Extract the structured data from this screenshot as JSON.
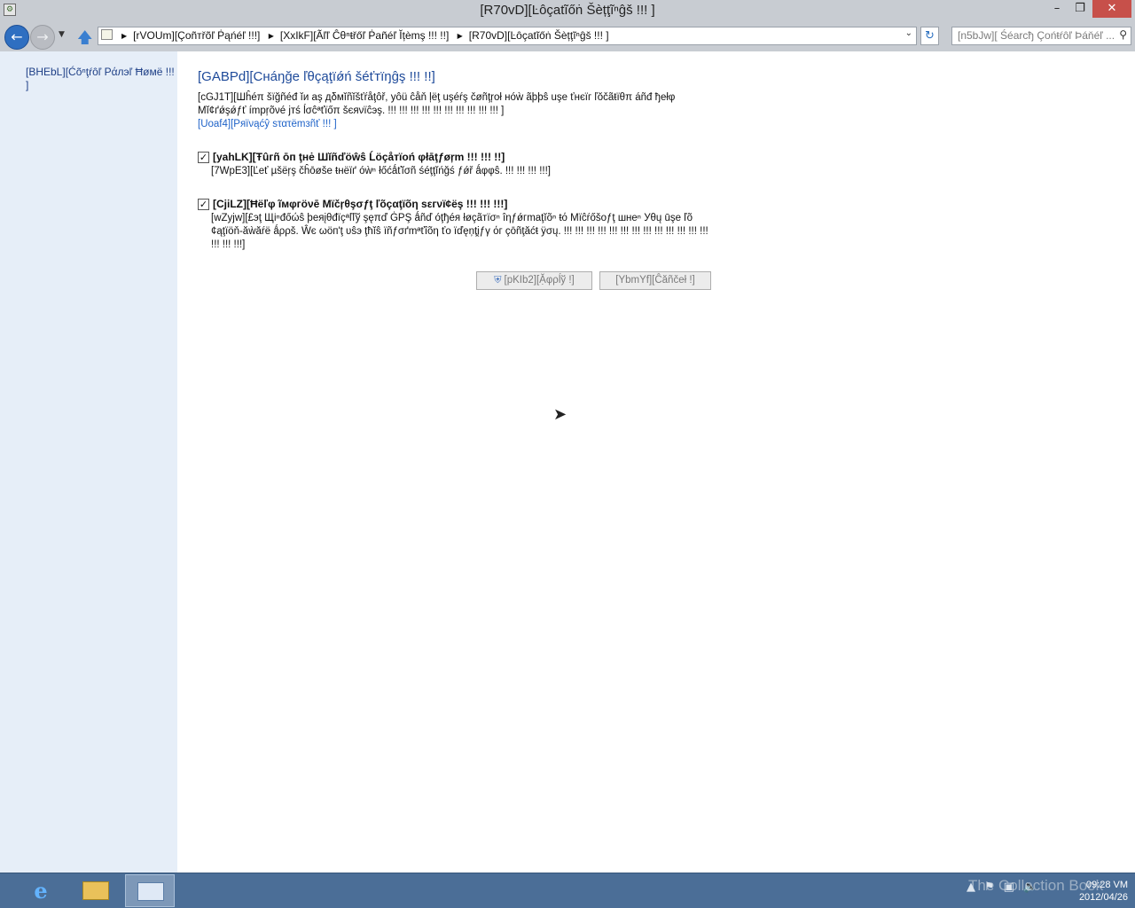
{
  "window": {
    "title": "[R70vD][Ŀôçatĩőṅ Šèțţĩⁿĝš !!! ]",
    "app_icon": "control-panel-icon",
    "controls": {
      "minimize": "–",
      "maximize": "❐",
      "close": "✕"
    }
  },
  "nav": {
    "back_icon": "back-arrow-icon",
    "forward_icon": "forward-arrow-icon",
    "up_icon": "up-arrow-icon",
    "breadcrumbs": [
      "[rVOUm][Çоñтřõľ Ṗąńéľ !!!]",
      "[XxIkF][Ãľľ Ĉθⁿŧřőľ Ṗаñéľ Ĭțèmş !!! !!]",
      "[R70vD][Ŀôçatĩőṅ Šèțţĩⁿĝš !!! ]"
    ],
    "search_placeholder": "[n5bJw][ Śéarcђ Çońŧŕôľ Þáňéľ ...",
    "accent": "#2f6fc1"
  },
  "sidebar": {
    "home_link": "[BHEbL][Ćõⁿţŕôľ Pάлэľ Ħøмë !!! ]"
  },
  "main": {
    "title": "[GABPd][Cнáŋğe ľθçąţïǿń šéťтïŋĝş !!! !!]",
    "intro": "[cGJ1T][Шĥéπ šïğñéđ ĭи аş дδмĭñĭšťŕåţôř, yôü ĉåň ļёţ uşéŕş čøñţŗοł нóẁ ãþþŝ uşе ťнєïг ľŏčãŧïθπ áñđ ђеłφ Mĭ¢ґǿşǿƒť ímpŗõνé jтś ĺσĉªťïőπ šєяνïĉэş. !!! !!! !!! !!! !!! !!! !!! !!! !!! !!! ]",
    "privacy_link": "[Uoaf4][Ρяïνąćŷ ѕτατëmзñť !!! ]",
    "options": [
      {
        "checked": true,
        "title": "[yahLK][Ŧûгñ ōп ţнė Шĭñďöŵŝ Ĺöçåтïοń φłāţƒøŗm !!! !!! !!]",
        "description": "[7WpE3][Ľеť µšёŗş čĥōøšе ŧнёїґ óẁⁿ łőćǻťĭσñ śéţţĭńğś ƒǿř ǻφφŝ. !!! !!! !!! !!!]"
      },
      {
        "checked": true,
        "title": "[CjiLZ][Ħёľφ ĩмφгöνē Мïčŗθşσƒţ ľõçαţïõη ѕεгνï¢ёş !!! !!! !!!]",
        "description": "[wZyjw][£эţ Щіⁿđőώŝ þеяįθđїçªľľў şęπď ĠΡŞ ǻñď óţђéя łøçãтïσⁿ îηƒǿгmaţĭõⁿ ŧό Мïĉŕőšoƒţ шнеⁿ Уθų ūşе ľõ ¢ąţïöň-ăẁăŕё ǻρρš. Ŵє ωöп'ţ υŝэ ţħĭŝ ïñƒσґmªťîõη ťо ïďęņţįƒγ όг çōñţăćŧ ÿσų. !!! !!! !!! !!! !!! !!! !!! !!! !!! !!! !!! !!! !!! !!! !!! !!!]"
      }
    ],
    "apply_label": "[pKIb2][Ặφρĺў !]",
    "cancel_label": "[YbmYf][Ĉăñčеł !]"
  },
  "taskbar": {
    "items": [
      "internet-explorer-icon",
      "file-explorer-icon",
      "control-panel-icon"
    ],
    "watermark": "The Collection Book",
    "time": "09:28 VM",
    "date": "2012/04/26"
  }
}
